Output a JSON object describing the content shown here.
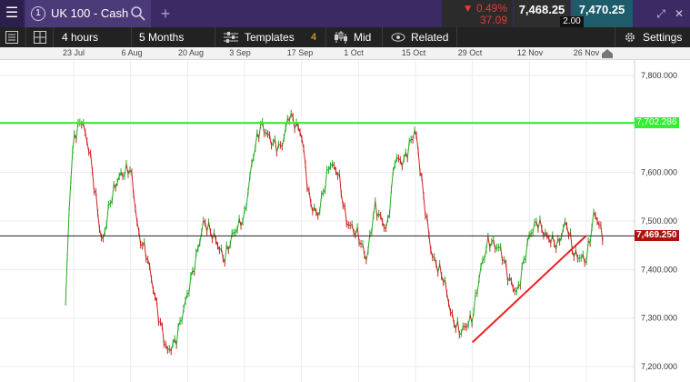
{
  "header": {
    "menu_icon": "hamburger-icon",
    "instrument_number": "1",
    "instrument_name": "UK 100 - Cash",
    "search_icon": "search-icon",
    "add_tab": "+",
    "change_percent": "▼ 0.49%",
    "change_points": "37.09",
    "sell_price": "7,468.25",
    "spread": "2.00",
    "buy_price": "7,470.25"
  },
  "toolbar": {
    "interval": "4 hours",
    "range": "5 Months",
    "templates": "Templates",
    "templates_count": "4",
    "price_type": "Mid",
    "related": "Related",
    "settings": "Settings"
  },
  "colors": {
    "up": "#22aa22",
    "down": "#cc2222",
    "resistance": "#33ee33",
    "support": "#ee2222",
    "current": "#222222",
    "current_tag": "#b01010"
  },
  "chart_data": {
    "type": "line",
    "instrument": "UK 100 - Cash",
    "x_ticks": [
      "23 Jul",
      "6 Aug",
      "20 Aug",
      "3 Sep",
      "17 Sep",
      "1 Oct",
      "15 Oct",
      "29 Oct",
      "12 Nov",
      "26 Nov"
    ],
    "y_ticks": [
      "7,800.000",
      "7,700.000",
      "7,600.000",
      "7,500.000",
      "7,400.000",
      "7,300.000",
      "7,200.000"
    ],
    "ylim": [
      7200,
      7800
    ],
    "resistance_label": "7,702.286",
    "resistance_value": 7702.286,
    "current_label": "7,469.250",
    "current_value": 7469.25,
    "support_line": {
      "start": [
        "29 Oct",
        7250
      ],
      "end": [
        "26 Nov",
        7470
      ]
    },
    "series": [
      {
        "x": [
          "21 Jul",
          "22 Jul",
          "23 Jul",
          "24 Jul",
          "25 Jul",
          "27 Jul",
          "30 Jul",
          "1 Aug",
          "3 Aug",
          "6 Aug",
          "8 Aug",
          "10 Aug",
          "13 Aug",
          "15 Aug",
          "17 Aug",
          "20 Aug",
          "22 Aug",
          "24 Aug",
          "27 Aug",
          "29 Aug",
          "31 Aug",
          "3 Sep",
          "5 Sep",
          "7 Sep",
          "10 Sep",
          "12 Sep",
          "14 Sep",
          "17 Sep",
          "19 Sep",
          "21 Sep",
          "24 Sep",
          "26 Sep",
          "28 Sep",
          "1 Oct",
          "3 Oct",
          "5 Oct",
          "8 Oct",
          "10 Oct",
          "12 Oct",
          "15 Oct",
          "17 Oct",
          "19 Oct",
          "22 Oct",
          "24 Oct",
          "26 Oct",
          "29 Oct",
          "31 Oct",
          "2 Nov",
          "5 Nov",
          "7 Nov",
          "9 Nov",
          "12 Nov",
          "14 Nov",
          "16 Nov",
          "19 Nov",
          "21 Nov",
          "23 Nov",
          "26 Nov",
          "28 Nov",
          "30 Nov"
        ],
        "values": [
          7320,
          7550,
          7670,
          7690,
          7710,
          7640,
          7450,
          7540,
          7590,
          7610,
          7470,
          7430,
          7300,
          7230,
          7250,
          7350,
          7420,
          7500,
          7460,
          7420,
          7470,
          7510,
          7630,
          7700,
          7660,
          7650,
          7720,
          7680,
          7540,
          7510,
          7620,
          7600,
          7500,
          7470,
          7420,
          7530,
          7480,
          7630,
          7620,
          7690,
          7550,
          7430,
          7380,
          7300,
          7270,
          7300,
          7400,
          7460,
          7440,
          7380,
          7350,
          7470,
          7500,
          7470,
          7450,
          7500,
          7430,
          7420,
          7520,
          7470
        ]
      }
    ]
  }
}
